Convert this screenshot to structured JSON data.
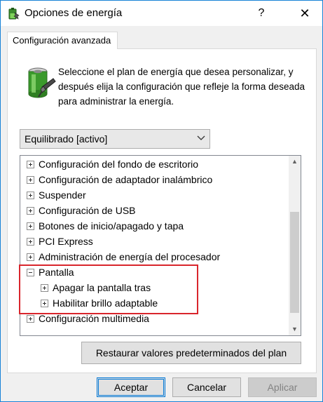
{
  "window": {
    "title": "Opciones de energía",
    "help_label": "?",
    "close_label": "✕"
  },
  "tab": {
    "label": "Configuración avanzada"
  },
  "description": "Seleccione el plan de energía que desea personalizar, y después elija la configuración que refleje la forma deseada para administrar la energía.",
  "plan_select": {
    "value": "Equilibrado [activo]"
  },
  "tree": {
    "items": [
      {
        "label": "Configuración del fondo de escritorio",
        "state": "collapsed"
      },
      {
        "label": "Configuración de adaptador inalámbrico",
        "state": "collapsed"
      },
      {
        "label": "Suspender",
        "state": "collapsed"
      },
      {
        "label": "Configuración de USB",
        "state": "collapsed"
      },
      {
        "label": "Botones de inicio/apagado y tapa",
        "state": "collapsed"
      },
      {
        "label": "PCI Express",
        "state": "collapsed"
      },
      {
        "label": "Administración de energía del procesador",
        "state": "collapsed"
      },
      {
        "label": "Pantalla",
        "state": "expanded"
      },
      {
        "label": "Apagar la pantalla tras",
        "state": "collapsed",
        "child": true
      },
      {
        "label": "Habilitar brillo adaptable",
        "state": "collapsed",
        "child": true
      },
      {
        "label": "Configuración multimedia",
        "state": "collapsed"
      }
    ]
  },
  "buttons": {
    "restore": "Restaurar valores predeterminados del plan",
    "ok": "Aceptar",
    "cancel": "Cancelar",
    "apply": "Aplicar"
  },
  "colors": {
    "highlight": "#d9252c",
    "accent": "#0078d7",
    "window_border": "#1883d7"
  },
  "icons": {
    "title": "power-options-icon",
    "battery": "battery-plan-icon"
  }
}
